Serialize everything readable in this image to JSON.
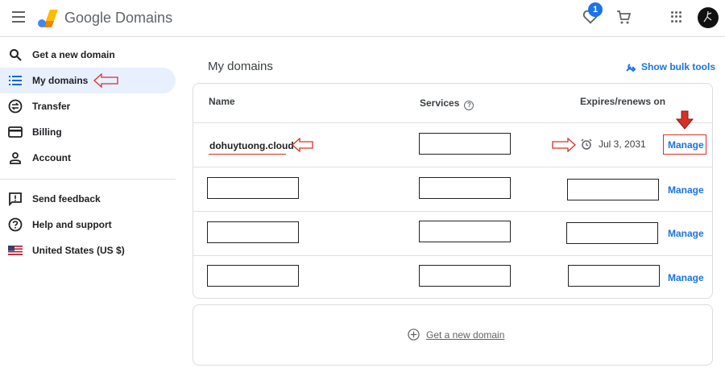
{
  "header": {
    "brand": "Google Domains",
    "favorites_badge": "1",
    "icons": [
      "menu-icon",
      "google-domains-logo",
      "favorites-heart-icon",
      "cart-icon",
      "apps-grid-icon",
      "avatar"
    ]
  },
  "sidebar": {
    "items": [
      {
        "label": "Get a new domain",
        "icon": "search-icon"
      },
      {
        "label": "My domains",
        "icon": "list-icon",
        "active": true
      },
      {
        "label": "Transfer",
        "icon": "transfer-icon"
      },
      {
        "label": "Billing",
        "icon": "billing-card-icon"
      },
      {
        "label": "Account",
        "icon": "account-icon"
      }
    ],
    "secondary": [
      {
        "label": "Send feedback",
        "icon": "feedback-icon"
      },
      {
        "label": "Help and support",
        "icon": "help-icon"
      },
      {
        "label": "United States (US $)",
        "icon": "us-flag-icon"
      }
    ]
  },
  "main": {
    "title": "My domains",
    "bulk_tools_label": "Show bulk tools",
    "table": {
      "columns": {
        "name": "Name",
        "services": "Services",
        "expires": "Expires/renews on"
      },
      "rows": [
        {
          "domain": "dohuytuong.cloud",
          "expires": "Jul 3, 2031",
          "action": "Manage"
        },
        {
          "domain": "",
          "expires": "",
          "action": "Manage"
        },
        {
          "domain": "",
          "expires": "",
          "action": "Manage"
        },
        {
          "domain": "",
          "expires": "",
          "action": "Manage"
        }
      ]
    },
    "add_domain_label": "Get a new domain"
  },
  "colors": {
    "accent": "#1a73e8",
    "active_bg": "#e8f0fe",
    "annotation_red": "#d93025"
  }
}
